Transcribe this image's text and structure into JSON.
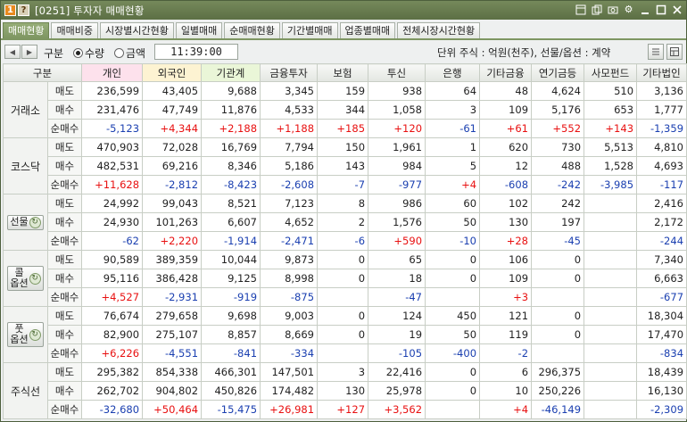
{
  "window": {
    "badge1": "1",
    "badge2": "?",
    "title": "[0251] 투자자 매매현황",
    "icons": [
      "window-icon",
      "copy-icon",
      "camera-icon",
      "gear-icon",
      "minimize-icon",
      "maximize-icon",
      "close-icon"
    ]
  },
  "tabs": [
    "매매현황",
    "매매비중",
    "시장별시간현황",
    "일별매매",
    "순매매현황",
    "기간별매매",
    "업종별매매",
    "전체시장시간현황"
  ],
  "toolbar": {
    "label": "구분",
    "radio_qty": "수량",
    "radio_amt": "금액",
    "selected": "수량",
    "time": "11:39:00",
    "unit": "단위 주식 : 억원(천주), 선물/옵션 : 계약"
  },
  "columns": [
    "구분",
    "개인",
    "외국인",
    "기관계",
    "금융투자",
    "보험",
    "투신",
    "은행",
    "기타금융",
    "연기금등",
    "사모펀드",
    "기타법인"
  ],
  "colors": {
    "positive": "#e81010",
    "negative": "#1a3fb0",
    "active_tab": "#7e9662"
  },
  "groups": [
    {
      "name": "거래소",
      "button": false,
      "rows": [
        {
          "label": "매도",
          "values": [
            "236,599",
            "43,405",
            "9,688",
            "3,345",
            "159",
            "938",
            "64",
            "48",
            "4,624",
            "510",
            "3,136"
          ]
        },
        {
          "label": "매수",
          "values": [
            "231,476",
            "47,749",
            "11,876",
            "4,533",
            "344",
            "1,058",
            "3",
            "109",
            "5,176",
            "653",
            "1,777"
          ]
        },
        {
          "label": "순매수",
          "values": [
            "-5,123",
            "+4,344",
            "+2,188",
            "+1,188",
            "+185",
            "+120",
            "-61",
            "+61",
            "+552",
            "+143",
            "-1,359"
          ]
        }
      ]
    },
    {
      "name": "코스닥",
      "button": false,
      "rows": [
        {
          "label": "매도",
          "values": [
            "470,903",
            "72,028",
            "16,769",
            "7,794",
            "150",
            "1,961",
            "1",
            "620",
            "730",
            "5,513",
            "4,810"
          ]
        },
        {
          "label": "매수",
          "values": [
            "482,531",
            "69,216",
            "8,346",
            "5,186",
            "143",
            "984",
            "5",
            "12",
            "488",
            "1,528",
            "4,693"
          ]
        },
        {
          "label": "순매수",
          "values": [
            "+11,628",
            "-2,812",
            "-8,423",
            "-2,608",
            "-7",
            "-977",
            "+4",
            "-608",
            "-242",
            "-3,985",
            "-117"
          ]
        }
      ]
    },
    {
      "name": "선물",
      "button": true,
      "rows": [
        {
          "label": "매도",
          "values": [
            "24,992",
            "99,043",
            "8,521",
            "7,123",
            "8",
            "986",
            "60",
            "102",
            "242",
            "",
            "2,416"
          ]
        },
        {
          "label": "매수",
          "values": [
            "24,930",
            "101,263",
            "6,607",
            "4,652",
            "2",
            "1,576",
            "50",
            "130",
            "197",
            "",
            "2,172"
          ]
        },
        {
          "label": "순매수",
          "values": [
            "-62",
            "+2,220",
            "-1,914",
            "-2,471",
            "-6",
            "+590",
            "-10",
            "+28",
            "-45",
            "",
            "-244"
          ]
        }
      ]
    },
    {
      "name": "콜옵션",
      "name_lines": [
        "콜",
        "옵션"
      ],
      "button": true,
      "rows": [
        {
          "label": "매도",
          "values": [
            "90,589",
            "389,359",
            "10,044",
            "9,873",
            "0",
            "65",
            "0",
            "106",
            "0",
            "",
            "7,340"
          ]
        },
        {
          "label": "매수",
          "values": [
            "95,116",
            "386,428",
            "9,125",
            "8,998",
            "0",
            "18",
            "0",
            "109",
            "0",
            "",
            "6,663"
          ]
        },
        {
          "label": "순매수",
          "values": [
            "+4,527",
            "-2,931",
            "-919",
            "-875",
            "",
            "-47",
            "",
            "+3",
            "",
            "",
            "-677"
          ]
        }
      ]
    },
    {
      "name": "풋옵션",
      "name_lines": [
        "풋",
        "옵션"
      ],
      "button": true,
      "rows": [
        {
          "label": "매도",
          "values": [
            "76,674",
            "279,658",
            "9,698",
            "9,003",
            "0",
            "124",
            "450",
            "121",
            "0",
            "",
            "18,304"
          ]
        },
        {
          "label": "매수",
          "values": [
            "82,900",
            "275,107",
            "8,857",
            "8,669",
            "0",
            "19",
            "50",
            "119",
            "0",
            "",
            "17,470"
          ]
        },
        {
          "label": "순매수",
          "values": [
            "+6,226",
            "-4,551",
            "-841",
            "-334",
            "",
            "-105",
            "-400",
            "-2",
            "",
            "",
            "-834"
          ]
        }
      ]
    },
    {
      "name": "주식선",
      "button": false,
      "rows": [
        {
          "label": "매도",
          "values": [
            "295,382",
            "854,338",
            "466,301",
            "147,501",
            "3",
            "22,416",
            "0",
            "6",
            "296,375",
            "",
            "18,439"
          ]
        },
        {
          "label": "매수",
          "values": [
            "262,702",
            "904,802",
            "450,826",
            "174,482",
            "130",
            "25,978",
            "0",
            "10",
            "250,226",
            "",
            "16,130"
          ]
        },
        {
          "label": "순매수",
          "values": [
            "-32,680",
            "+50,464",
            "-15,475",
            "+26,981",
            "+127",
            "+3,562",
            "",
            "+4",
            "-46,149",
            "",
            "-2,309"
          ]
        }
      ]
    }
  ]
}
